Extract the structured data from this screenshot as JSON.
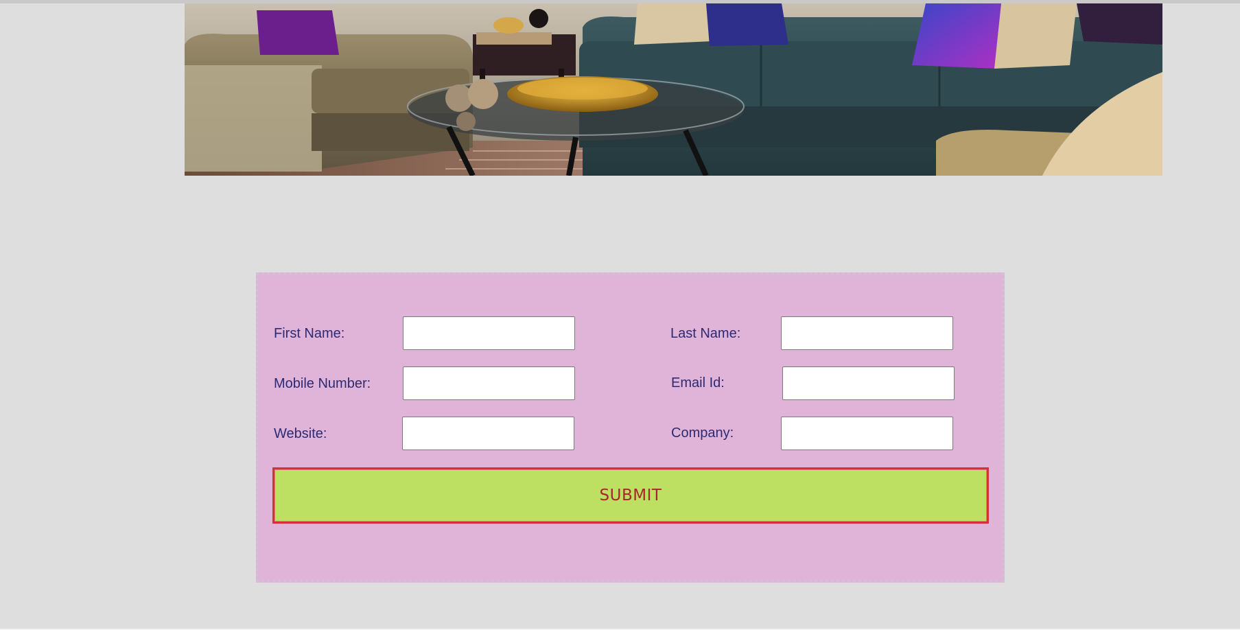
{
  "hero": {
    "image_alt": "living room with sofa, armchair and glass coffee table"
  },
  "form": {
    "fields": {
      "first_name": {
        "label": "First Name:",
        "value": "",
        "placeholder": ""
      },
      "last_name": {
        "label": "Last Name:",
        "value": "",
        "placeholder": ""
      },
      "mobile_number": {
        "label": "Mobile Number:",
        "value": "",
        "placeholder": ""
      },
      "email_id": {
        "label": "Email Id:",
        "value": "",
        "placeholder": ""
      },
      "website": {
        "label": "Website:",
        "value": "",
        "placeholder": ""
      },
      "company": {
        "label": "Company:",
        "value": "",
        "placeholder": ""
      }
    },
    "submit_label": "SUBMIT"
  },
  "colors": {
    "page_background": "#dedede",
    "panel_background": "#e0b3d9",
    "label_text": "#2b2a72",
    "submit_background": "#bde063",
    "submit_border": "#d4313b",
    "submit_text": "#a4282a"
  }
}
